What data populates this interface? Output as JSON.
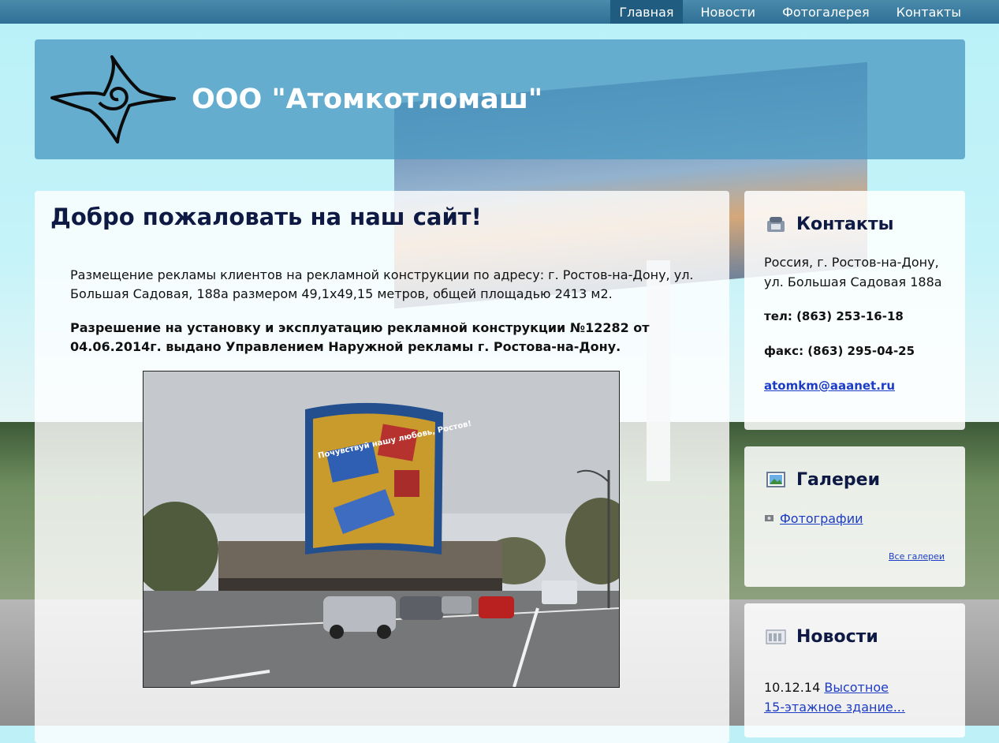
{
  "nav": {
    "items": [
      {
        "label": "Главная",
        "active": true
      },
      {
        "label": "Новости",
        "active": false
      },
      {
        "label": "Фотогалерея",
        "active": false
      },
      {
        "label": "Контакты",
        "active": false
      }
    ]
  },
  "header": {
    "title": "ООО \"Атомкотломаш\""
  },
  "main": {
    "heading": "Добро пожаловать на наш сайт!",
    "paragraph1": "Размещение рекламы клиентов на рекламной конструкции по адресу: г. Ростов-на-Дону, ул. Большая Садовая, 188а размером 49,1х49,15 метров, общей площадью 2413 м2.",
    "paragraph2": "Разрешение на установку и эксплуатацию рекламной конструкции №12282 от 04.06.2014г. выдано Управлением Наружной рекламы г. Ростова-на-Дону.",
    "photo_banner_text": "Почувствуй нашу любовь, Ростов!"
  },
  "contacts": {
    "title": "Контакты",
    "address_line1": "Россия, г. Ростов-на-Дону,",
    "address_line2": "ул. Большая Садовая 188а",
    "phone": "тел: (863) 253-16-18",
    "fax": "факс: (863) 295-04-25",
    "email": "atomkm@aaanet.ru"
  },
  "galleries": {
    "title": "Галереи",
    "item": "Фотографии",
    "all_link": "Все галереи"
  },
  "news": {
    "title": "Новости",
    "date": "10.12.14",
    "item_line1": "Высотное",
    "item_line2": "15-этажное здание..."
  }
}
